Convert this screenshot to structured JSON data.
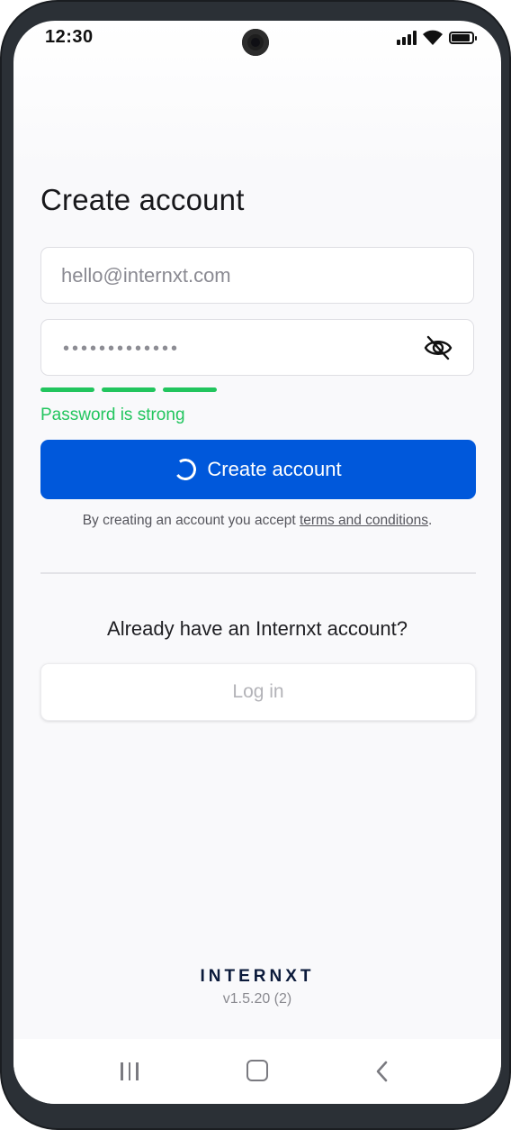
{
  "status_bar": {
    "time": "12:30",
    "icons": [
      "signal-icon",
      "wifi-icon",
      "battery-icon"
    ]
  },
  "signup": {
    "title": "Create account",
    "email": {
      "value": "",
      "placeholder": "hello@internxt.com"
    },
    "password": {
      "masked_value": "•••••••••••••",
      "visibility_icon": "eye-off-icon"
    },
    "strength": {
      "segments_filled": 3,
      "label": "Password is strong",
      "color": "#22c55e"
    },
    "submit_label": "Create account",
    "submit_loading": true,
    "terms": {
      "prefix": "By creating an account you accept ",
      "link": "terms and conditions",
      "suffix": "."
    }
  },
  "login": {
    "prompt": "Already have an Internxt account?",
    "button_label": "Log in"
  },
  "footer": {
    "brand": "INTERNXT",
    "version": "v1.5.20 (2)"
  },
  "nav_bar": {
    "items": [
      "recents-icon",
      "home-icon",
      "back-icon"
    ]
  },
  "colors": {
    "primary": "#0058db",
    "success": "#22c55e",
    "brand_text": "#0b1a3b"
  }
}
